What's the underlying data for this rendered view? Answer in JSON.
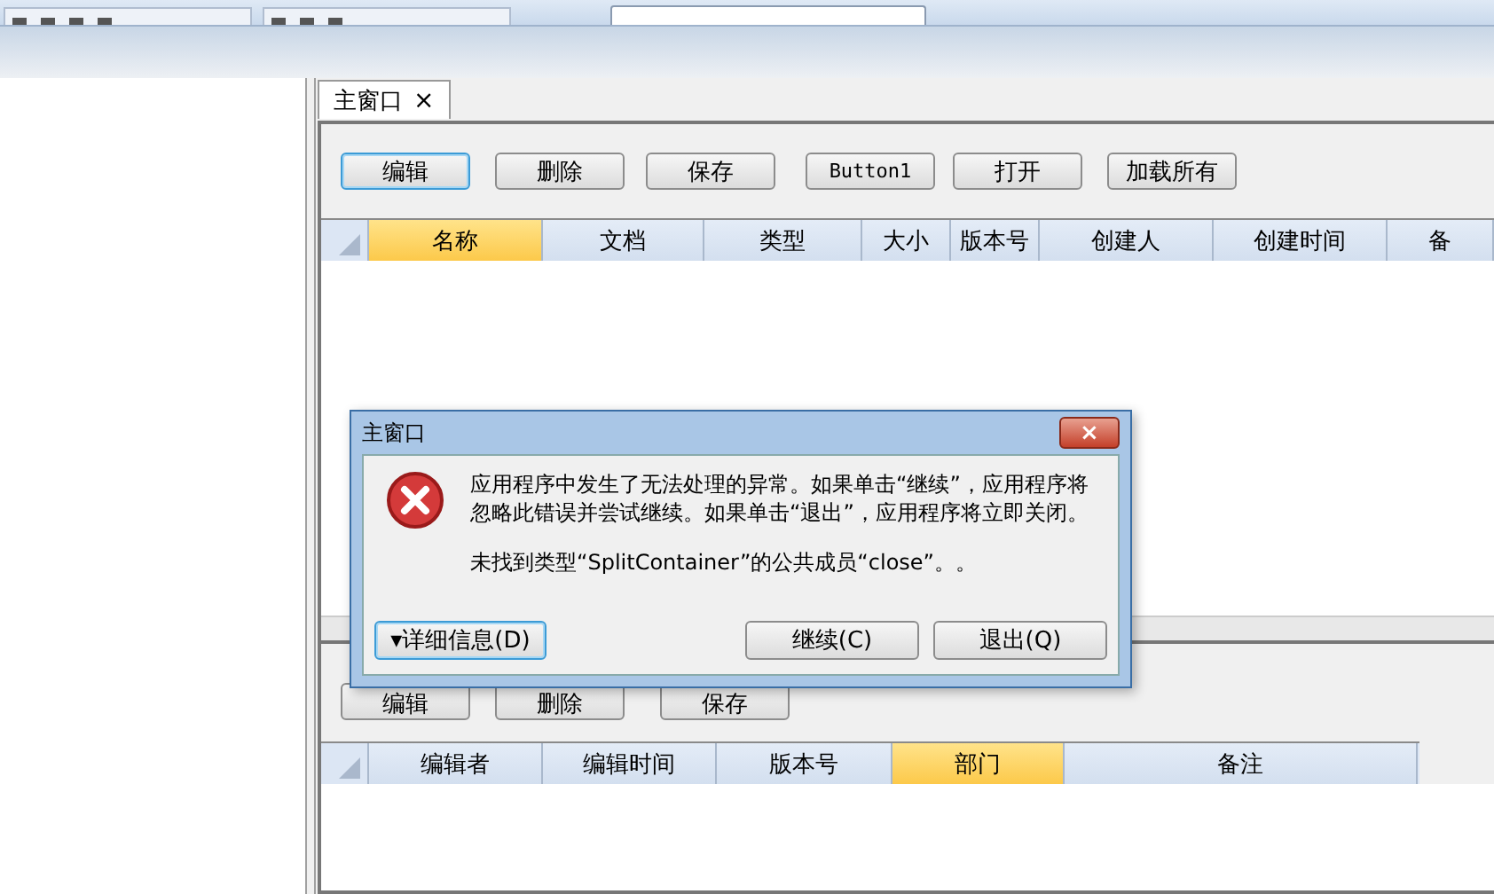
{
  "tabs": [
    {
      "label": "主窗口",
      "close": "×",
      "selected": true
    }
  ],
  "toolbar_buttons": [
    {
      "label": "编辑",
      "focused": true
    },
    {
      "label": "删除",
      "focused": false
    },
    {
      "label": "保存",
      "focused": false
    },
    {
      "label": "Button1",
      "focused": false
    },
    {
      "label": "打开",
      "focused": false
    },
    {
      "label": "加载所有",
      "focused": false
    }
  ],
  "main_table": {
    "columns": [
      {
        "label": "名称",
        "selected": true
      },
      {
        "label": "文档",
        "selected": false
      },
      {
        "label": "类型",
        "selected": false
      },
      {
        "label": "大小",
        "selected": false
      },
      {
        "label": "版本号",
        "selected": false
      },
      {
        "label": "创建人",
        "selected": false
      },
      {
        "label": "创建时间",
        "selected": false
      },
      {
        "label": "备",
        "selected": false
      }
    ]
  },
  "detail_buttons": [
    {
      "label": "编辑"
    },
    {
      "label": "删除"
    },
    {
      "label": "保存"
    }
  ],
  "detail_table": {
    "columns": [
      {
        "label": "编辑者",
        "selected": false
      },
      {
        "label": "编辑时间",
        "selected": false
      },
      {
        "label": "版本号",
        "selected": false
      },
      {
        "label": "部门",
        "selected": true
      },
      {
        "label": "备注",
        "selected": false
      }
    ]
  },
  "dialog": {
    "title": "主窗口",
    "close": "×",
    "message": "应用程序中发生了无法处理的异常。如果单击“继续”，应用程序将忽略此错误并尝试继续。如果单击“退出”，应用程序将立即关闭。",
    "detail": "未找到类型“SplitContainer”的公共成员“close”。。",
    "details_button": "▾详细信息(D)",
    "buttons": [
      "继续(C)",
      "退出(Q)"
    ]
  }
}
